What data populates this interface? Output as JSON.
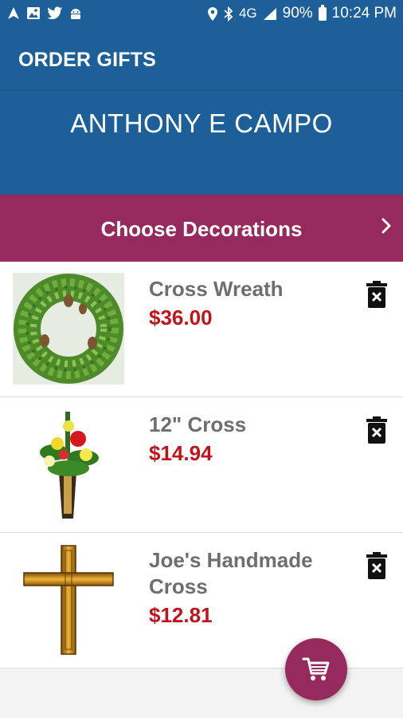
{
  "status_bar": {
    "time": "10:24 PM",
    "battery": "90%",
    "network": "4G"
  },
  "app_bar": {
    "title": "ORDER GIFTS"
  },
  "recipient": {
    "name": "ANTHONY E CAMPO"
  },
  "decorations": {
    "label": "Choose Decorations"
  },
  "items": [
    {
      "name": "Cross Wreath",
      "price": "$36.00",
      "image": "wreath-image"
    },
    {
      "name": "12\" Cross",
      "price": "$14.94",
      "image": "flower-cross-image"
    },
    {
      "name": "Joe's Handmade Cross",
      "price": "$12.81",
      "image": "gold-cross-image"
    }
  ],
  "colors": {
    "primary": "#1d5f98",
    "accent": "#962a5d",
    "price": "#c2131b",
    "item_text": "#6e6e6e"
  }
}
